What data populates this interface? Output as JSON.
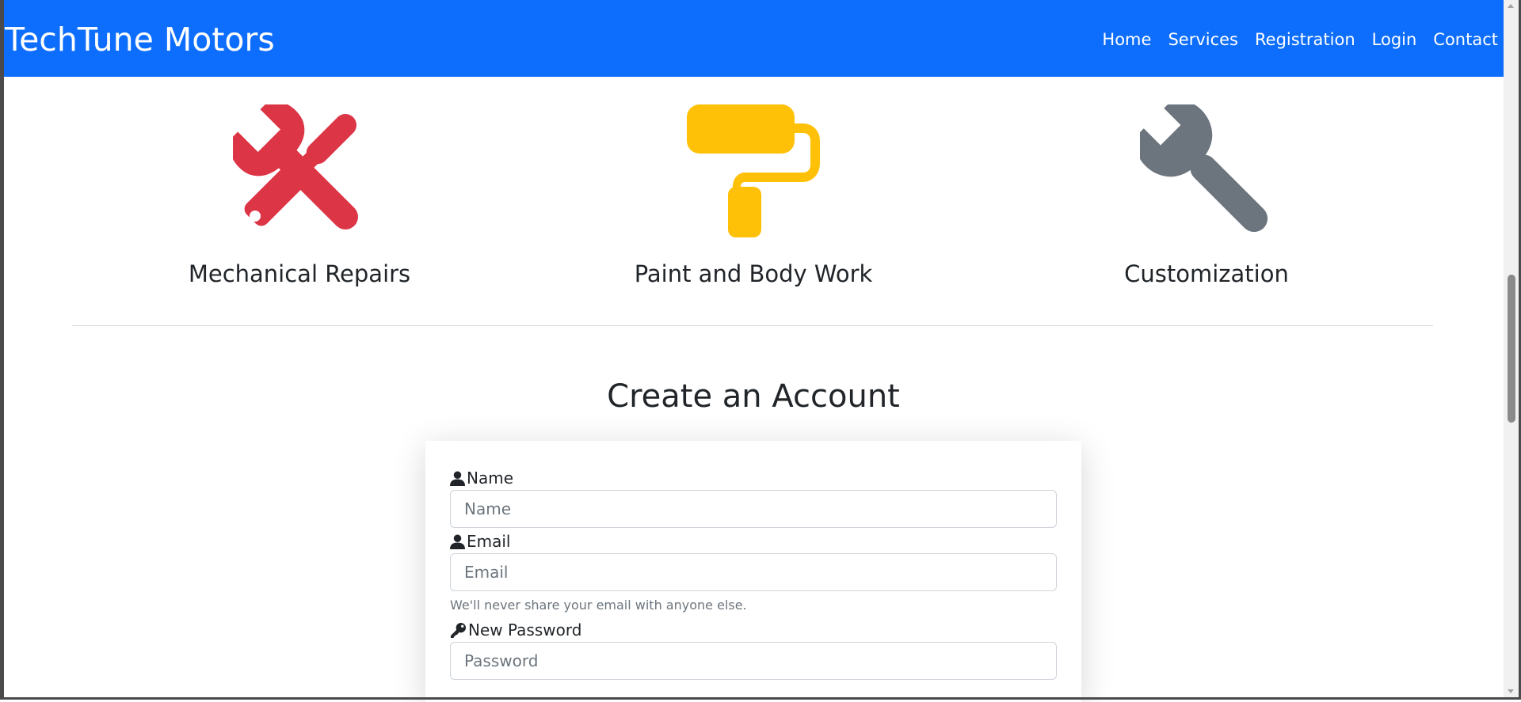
{
  "navbar": {
    "brand": "TechTune Motors",
    "links": [
      "Home",
      "Services",
      "Registration",
      "Login",
      "Contact"
    ],
    "color": "#0d6efd"
  },
  "services": [
    {
      "title": "Mechanical Repairs",
      "icon": "tools-icon",
      "color": "#dc3545"
    },
    {
      "title": "Paint and Body Work",
      "icon": "paint-roller-icon",
      "color": "#ffc107"
    },
    {
      "title": "Customization",
      "icon": "wrench-icon",
      "color": "#6c757d"
    }
  ],
  "form": {
    "heading": "Create an Account",
    "name_label": "Name",
    "name_placeholder": "Name",
    "email_label": "Email",
    "email_placeholder": "Email",
    "email_help": "We'll never share your email with anyone else.",
    "password_label": "New Password",
    "password_placeholder": "Password"
  }
}
